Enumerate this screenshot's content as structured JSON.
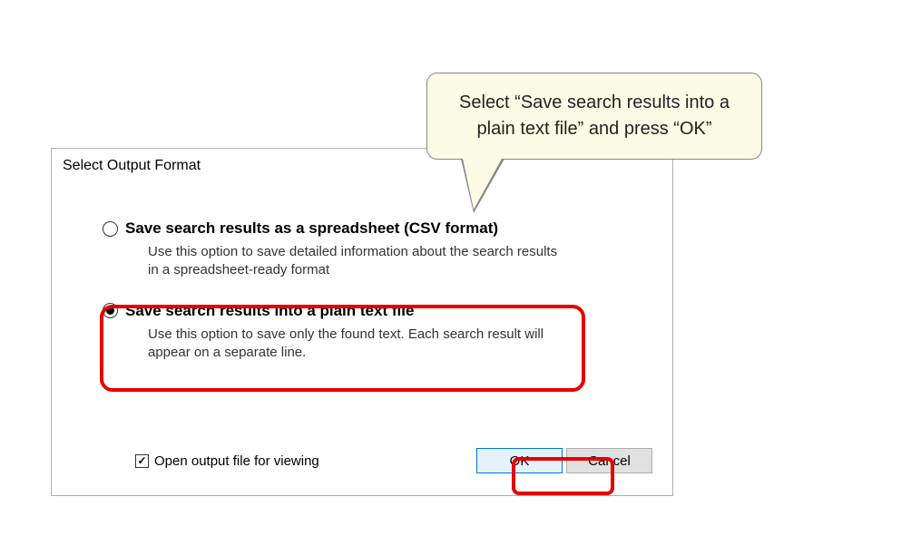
{
  "callout": {
    "text": "Select “Save search results into a plain text file” and press “OK”"
  },
  "dialog": {
    "title": "Select Output Format",
    "options": [
      {
        "title": "Save search results as a spreadsheet (CSV format)",
        "desc": "Use this option to save detailed information about the search results in a spreadsheet-ready format",
        "selected": false
      },
      {
        "title": "Save search results into a plain text file",
        "desc": "Use this option to save only the found text. Each search result will appear on a separate line.",
        "selected": true
      }
    ],
    "checkbox": {
      "label": "Open output file for viewing",
      "checked": true
    },
    "buttons": {
      "ok": "OK",
      "cancel": "Cancel"
    }
  }
}
